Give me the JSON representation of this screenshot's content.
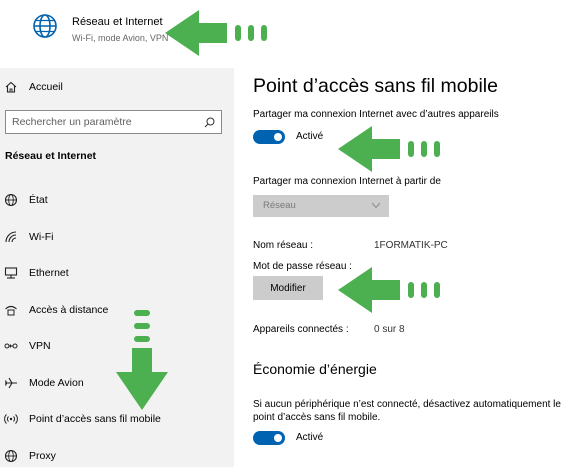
{
  "header": {
    "title": "Réseau et Internet",
    "subtitle": "Wi-Fi, mode Avion, VPN",
    "icon": "globe-icon"
  },
  "sidebar": {
    "home_label": "Accueil",
    "search_placeholder": "Rechercher un paramètre",
    "section_title": "Réseau et Internet",
    "items": [
      {
        "label": "État",
        "icon": "status-icon"
      },
      {
        "label": "Wi-Fi",
        "icon": "wifi-icon"
      },
      {
        "label": "Ethernet",
        "icon": "ethernet-icon"
      },
      {
        "label": "Accès à distance",
        "icon": "dialup-icon"
      },
      {
        "label": "VPN",
        "icon": "vpn-icon"
      },
      {
        "label": "Mode Avion",
        "icon": "airplane-icon"
      },
      {
        "label": "Point d’accès sans fil mobile",
        "icon": "hotspot-icon"
      },
      {
        "label": "Proxy",
        "icon": "proxy-icon"
      }
    ]
  },
  "main": {
    "title": "Point d’accès sans fil mobile",
    "share_label": "Partager ma connexion Internet avec d’autres appareils",
    "share_toggle_label": "Activé",
    "share_toggle_on": true,
    "share_from_label": "Partager ma connexion Internet à partir de",
    "share_from_value": "Réseau",
    "network_name_label": "Nom réseau :",
    "network_name_value": "1FORMATIK-PC",
    "password_label": "Mot de passe réseau :",
    "modify_button": "Modifier",
    "connected_label": "Appareils connectés :",
    "connected_value": "0 sur 8",
    "energy_title": "Économie d’énergie",
    "energy_desc": "Si aucun périphérique n’est connecté, désactivez automatiquement le point d’accès sans fil mobile.",
    "energy_toggle_label": "Activé",
    "energy_toggle_on": true
  },
  "colors": {
    "accent": "#0063b1",
    "arrow": "#4caf50",
    "sidebar_bg": "#f2f2f2",
    "disabled_bg": "#cccccc"
  }
}
